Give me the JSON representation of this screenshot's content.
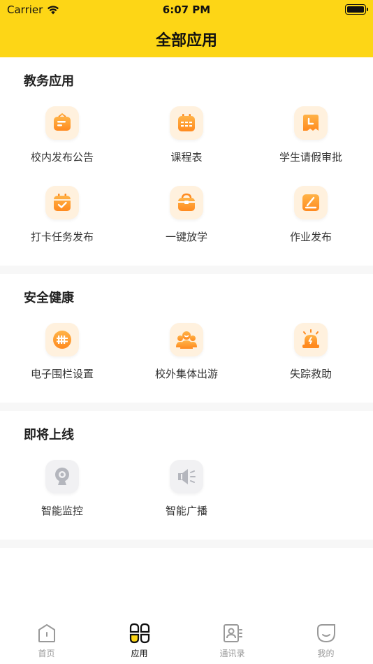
{
  "status": {
    "carrier": "Carrier",
    "time": "6:07 PM"
  },
  "header": {
    "title": "全部应用"
  },
  "sections": [
    {
      "title": "教务应用",
      "items": [
        {
          "label": "校内发布公告",
          "icon": "announcement-icon"
        },
        {
          "label": "课程表",
          "icon": "calendar-icon"
        },
        {
          "label": "学生请假审批",
          "icon": "leave-approval-icon"
        },
        {
          "label": "打卡任务发布",
          "icon": "checkin-icon"
        },
        {
          "label": "一键放学",
          "icon": "school-bag-icon"
        },
        {
          "label": "作业发布",
          "icon": "homework-icon"
        }
      ]
    },
    {
      "title": "安全健康",
      "items": [
        {
          "label": "电子围栏设置",
          "icon": "fence-icon"
        },
        {
          "label": "校外集体出游",
          "icon": "group-outing-icon"
        },
        {
          "label": "失踪救助",
          "icon": "alarm-icon"
        }
      ]
    },
    {
      "title": "即将上线",
      "items": [
        {
          "label": "智能监控",
          "icon": "camera-icon"
        },
        {
          "label": "智能广播",
          "icon": "speaker-icon"
        }
      ]
    }
  ],
  "tabbar": [
    {
      "label": "首页",
      "icon": "home-icon"
    },
    {
      "label": "应用",
      "icon": "apps-icon",
      "active": true
    },
    {
      "label": "通讯录",
      "icon": "contacts-icon"
    },
    {
      "label": "我的",
      "icon": "profile-icon"
    }
  ],
  "colors": {
    "accent": "#FDD616",
    "icon_orange": "#FF9A2E",
    "icon_bg": "#FFF1DE",
    "inactive": "#999999"
  }
}
